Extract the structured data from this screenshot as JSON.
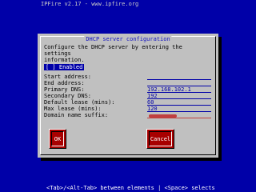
{
  "header": "IPFire v2.17 - www.ipfire.org",
  "dialog": {
    "title": "DHCP server configuration",
    "description": "Configure the DHCP server by entering the settings\ninformation.",
    "enabled_checkbox": "[ ] Enabled",
    "fields": [
      {
        "label": "Start address:",
        "value": ""
      },
      {
        "label": "End address:",
        "value": ""
      },
      {
        "label": "Primary DNS:",
        "value": "192.168.102.1_"
      },
      {
        "label": "Secondary DNS:",
        "value": "192"
      },
      {
        "label": "Default lease (mins):",
        "value": "60"
      },
      {
        "label": "Max lease (mins):",
        "value": "120"
      },
      {
        "label": "Domain name suffix:",
        "value": ""
      }
    ],
    "ok_label": "OK",
    "cancel_label": "Cancel"
  },
  "footer": "<Tab>/<Alt-Tab> between elements   |  <Space> selects",
  "colors": {
    "background": "#0000a8",
    "dialog": "#c0c0c0",
    "button": "#a80000",
    "highlight": "#c04040"
  }
}
